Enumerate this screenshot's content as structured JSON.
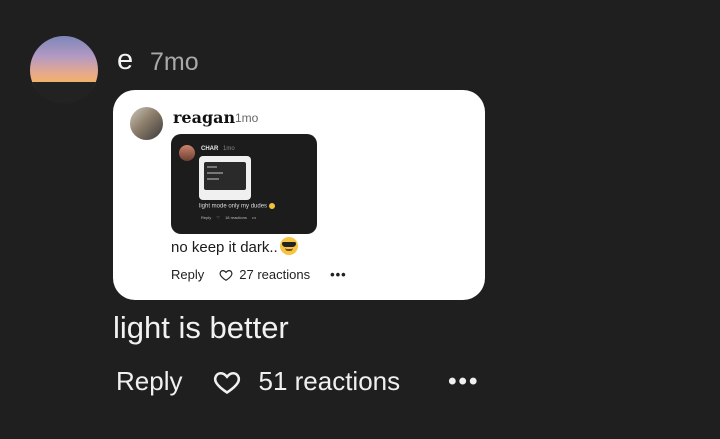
{
  "comment": {
    "author": "e",
    "time": "7mo",
    "body": "light is better",
    "reply_label": "Reply",
    "reactions_label": "51 reactions",
    "more_label": "•••"
  },
  "quote": {
    "author": "reagan",
    "time": "1mo",
    "body": "no keep it dark..",
    "reply_label": "Reply",
    "reactions_label": "27 reactions",
    "more_label": "•••",
    "emoji": "sunglasses-emoji",
    "nested": {
      "author": "CHAR",
      "time": "1mo",
      "body": "light mode only my dudes",
      "reply_label": "Reply",
      "reactions_label": "18 reactions",
      "more_label": "•••"
    }
  },
  "icons": {
    "heart": "heart-outline-icon",
    "more": "more-dots-icon"
  }
}
